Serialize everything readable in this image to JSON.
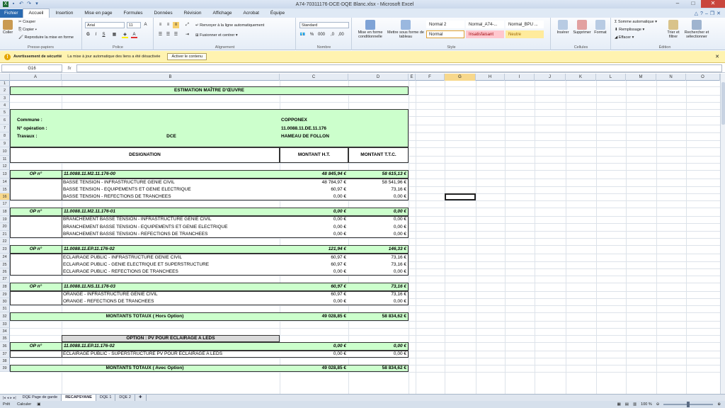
{
  "app": {
    "title": "A74-70311176-DCE-DQE Blanc.xlsx - Microsoft Excel"
  },
  "ribbon": {
    "tabs": [
      "Fichier",
      "Accueil",
      "Insertion",
      "Mise en page",
      "Formules",
      "Données",
      "Révision",
      "Affichage",
      "Acrobat",
      "Équipe"
    ],
    "clipboard": {
      "paste": "Coller",
      "cut": "Couper",
      "copy": "Copier",
      "format_painter": "Reproduire la mise en forme",
      "label": "Presse-papiers"
    },
    "font": {
      "name": "Arial",
      "size": "11",
      "label": "Police"
    },
    "alignment": {
      "wrap": "Renvoyer à la ligne automatiquement",
      "merge": "Fusionner et centrer",
      "label": "Alignement"
    },
    "number": {
      "format": "Standard",
      "label": "Nombre"
    },
    "styles": {
      "conditional": "Mise en forme conditionnelle",
      "table": "Mettre sous forme de tableau",
      "normal2": "Normal 2",
      "normal_a74": "Normal_A74-...",
      "normal_bpu": "Normal_BPU ...",
      "normal": "Normal",
      "insatisfaisant": "Insatisfaisant",
      "neutre": "Neutre",
      "label": "Style"
    },
    "cells": {
      "insert": "Insérer",
      "delete": "Supprimer",
      "format": "Format",
      "label": "Cellules"
    },
    "editing": {
      "autosum": "Somme automatique",
      "fill": "Remplissage",
      "clear": "Effacer",
      "sort": "Trier et filtrer",
      "find": "Rechercher et sélectionner",
      "label": "Édition"
    }
  },
  "security": {
    "title": "Avertissement de sécurité",
    "message": "La mise à jour automatique des liens a été désactivée",
    "button": "Activer le contenu"
  },
  "formula": {
    "namebox": "G16",
    "fx": "fx"
  },
  "columns": [
    "A",
    "B",
    "C",
    "D",
    "E",
    "F",
    "G",
    "H",
    "I",
    "J",
    "K",
    "L",
    "M",
    "N",
    "O"
  ],
  "rows": [
    "1",
    "2",
    "3",
    "4",
    "5",
    "6",
    "7",
    "8",
    "9",
    "10",
    "11",
    "12",
    "13",
    "14",
    "15",
    "16",
    "17",
    "18",
    "19",
    "20",
    "21",
    "22",
    "23",
    "24",
    "25",
    "26",
    "27",
    "28",
    "29",
    "30",
    "31",
    "32",
    "33",
    "34",
    "35",
    "36",
    "37",
    "38",
    "39"
  ],
  "sheet": {
    "title": "ESTIMATION MAÎTRE D'ŒUVRE",
    "commune_label": "Commune :",
    "commune_value": "COPPONEX",
    "operation_label": "N° opération :",
    "operation_value": "11.0088.11.DE.11.176",
    "travaux_label": "Travaux :",
    "travaux_mid": "DCE",
    "travaux_value": "HAMEAU DE FOLLON",
    "h_designation": "DESIGNATION",
    "h_ht": "MONTANT H.T.",
    "h_ttc": "MONTANT T.T.C.",
    "op_label": "OP n°",
    "op1": {
      "code": "11.0088.11.M2.11.176-00",
      "ht": "48 845,94 €",
      "ttc": "58 615,13 €",
      "lines": [
        [
          "BASSE TENSION - INFRASTRUCTURE GENIE CIVIL",
          "48 784,97 €",
          "58 541,96 €"
        ],
        [
          "BASSE TENSION - EQUIPEMENTS ET GENIE ELECTRIQUE",
          "60,97 €",
          "73,16 €"
        ],
        [
          "BASSE TENSION - REFECTIONS DE TRANCHEES",
          "0,00 €",
          "0,00 €"
        ]
      ]
    },
    "op2": {
      "code": "11.0088.11.M2.11.176-01",
      "ht": "0,00 €",
      "ttc": "0,00 €",
      "lines": [
        [
          "BRANCHEMENT BASSE TENSION - INFRASTRUCTURE GENIE CIVIL",
          "0,00 €",
          "0,00 €"
        ],
        [
          "BRANCHEMENT BASSE TENSION - EQUIPEMENTS ET GENIE ELECTRIQUE",
          "0,00 €",
          "0,00 €"
        ],
        [
          "BRANCHEMENT BASSE TENSION - REFECTIONS DE TRANCHEES",
          "0,00 €",
          "0,00 €"
        ]
      ]
    },
    "op3": {
      "code": "11.0088.11.EP.11.176-02",
      "ht": "121,94 €",
      "ttc": "146,33 €",
      "lines": [
        [
          "ECLAIRAGE PUBLIC - INFRASTRUCTURE GENIE CIVIL",
          "60,97 €",
          "73,16 €"
        ],
        [
          "ECLAIRAGE PUBLIC - GENIE ELECTRIQUE ET SUPERSTRUCTURE",
          "60,97 €",
          "73,16 €"
        ],
        [
          "ECLAIRAGE PUBLIC - REFECTIONS DE TRANCHEES",
          "0,00 €",
          "0,00 €"
        ]
      ]
    },
    "op4": {
      "code": "11.0088.11.NS.11.176-03",
      "ht": "60,97 €",
      "ttc": "73,16 €",
      "lines": [
        [
          "ORANGE - INFRASTRUCTURE GENIE CIVIL",
          "60,97 €",
          "73,16 €"
        ],
        [
          "ORANGE - REFECTIONS DE TRANCHEES",
          "0,00 €",
          "0,00 €"
        ]
      ]
    },
    "total_label": "MONTANTS TOTAUX ( Hors Option)",
    "total_ht": "49 028,85 €",
    "total_ttc": "58 834,62 €",
    "option_title": "OPTION : PV POUR ECLAIRAGE A LEDS",
    "op5": {
      "code": "11.0088.11.EP.11.176-02",
      "ht": "0,00 €",
      "ttc": "0,00 €",
      "lines": [
        [
          "ECLAIRAGE PUBLIC - SUPERSTRUCTURE PV POUR ECLAIRAGE A LEDS",
          "0,00 €",
          "0,00 €"
        ]
      ]
    },
    "total2_label": "MONTANTS TOTAUX ( Avec Option)",
    "total2_ht": "49 028,85 €",
    "total2_ttc": "58 834,62 €"
  },
  "sheettabs": [
    "DQE Page de garde",
    "RECAPSYANE",
    "DQE 1",
    "DQE 2"
  ],
  "status": {
    "left": "Prêt",
    "calc": "Calculer",
    "zoom": "100 %"
  }
}
